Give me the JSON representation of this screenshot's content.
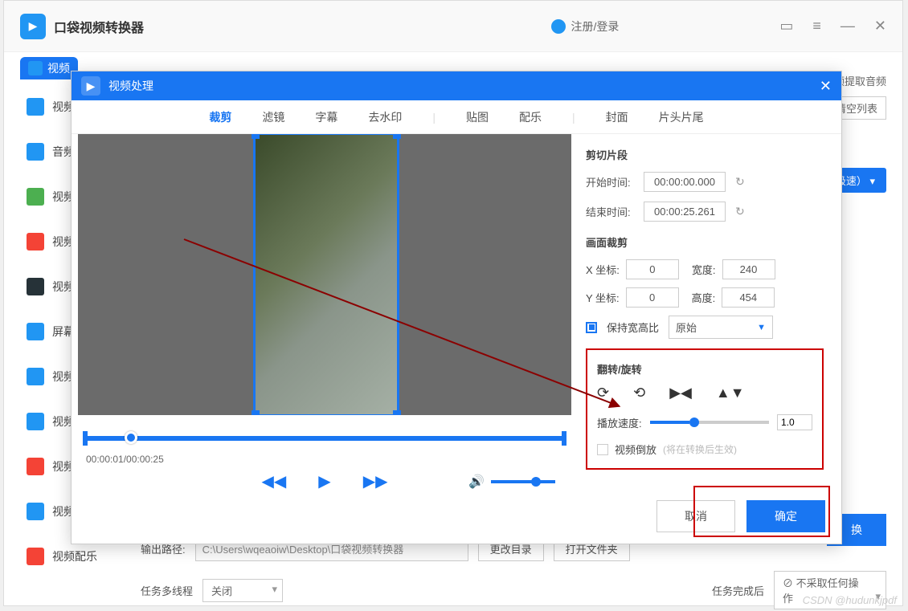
{
  "app": {
    "title": "口袋视频转换器",
    "user": "注册/登录"
  },
  "mainTabs": {
    "t0": "视频"
  },
  "rightTop": {
    "extract": "视频提取音频",
    "clear": "清空列表",
    "speed": "极速）"
  },
  "sidebar": [
    "视频",
    "音频",
    "视频",
    "视频",
    "视频",
    "屏幕",
    "视频",
    "视频",
    "视频",
    "视频",
    "视频配乐"
  ],
  "bottom": {
    "outLabel": "输出路径:",
    "outPath": "C:\\Users\\wqeaoiw\\Desktop\\口袋视频转换器",
    "changeDir": "更改目录",
    "openFolder": "打开文件夹",
    "threadLabel": "任务多线程",
    "threadVal": "关闭",
    "afterLabel": "任务完成后",
    "afterVal": "不采取任何操作",
    "convert": "换"
  },
  "modal": {
    "title": "视频处理",
    "tabs": [
      "裁剪",
      "滤镜",
      "字幕",
      "去水印",
      "贴图",
      "配乐",
      "封面",
      "片头片尾"
    ],
    "time": "00:00:01/00:00:25",
    "clip": {
      "title": "剪切片段",
      "startLabel": "开始时间:",
      "start": "00:00:00.000",
      "endLabel": "结束时间:",
      "end": "00:00:25.261"
    },
    "crop": {
      "title": "画面裁剪",
      "xLabel": "X 坐标:",
      "x": "0",
      "yLabel": "Y 坐标:",
      "y": "0",
      "wLabel": "宽度:",
      "w": "240",
      "hLabel": "高度:",
      "h": "454",
      "keepRatio": "保持宽高比",
      "ratioVal": "原始"
    },
    "rotate": {
      "title": "翻转/旋转",
      "speedLabel": "播放速度:",
      "speedVal": "1.0",
      "reverse": "视频倒放",
      "reverseHint": "(将在转换后生效)"
    },
    "footer": {
      "cancel": "取消",
      "ok": "确定"
    }
  },
  "watermark": "CSDN @hudunkjpdf"
}
